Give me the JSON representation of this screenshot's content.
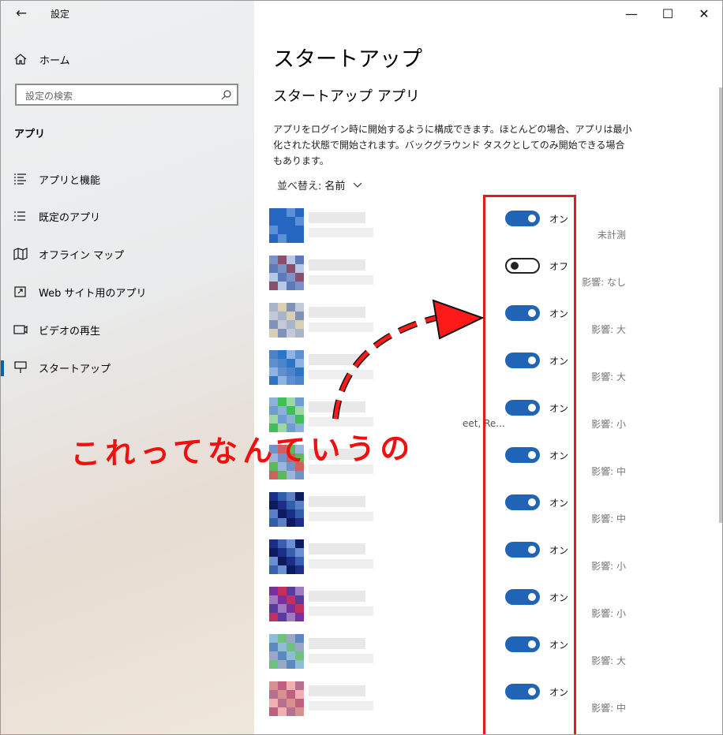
{
  "window": {
    "title": "設定",
    "controls": {
      "minimize": "—",
      "maximize": "☐",
      "close": "✕"
    }
  },
  "sidebar": {
    "home": "ホーム",
    "search_placeholder": "設定の検索",
    "section": "アプリ",
    "items": [
      {
        "label": "アプリと機能",
        "icon": "list-icon"
      },
      {
        "label": "既定のアプリ",
        "icon": "default-apps-icon"
      },
      {
        "label": "オフライン マップ",
        "icon": "map-icon"
      },
      {
        "label": "Web サイト用のアプリ",
        "icon": "open-in-app-icon"
      },
      {
        "label": "ビデオの再生",
        "icon": "video-icon"
      },
      {
        "label": "スタートアップ",
        "icon": "startup-icon",
        "selected": true
      }
    ]
  },
  "main": {
    "title": "スタートアップ",
    "subtitle": "スタートアップ アプリ",
    "description": "アプリをログイン時に開始するように構成できます。ほとんどの場合、アプリは最小化された状態で開始されます。バックグラウンド タスクとしてのみ開始できる場合もあります。",
    "sort_label": "並べ替え:",
    "sort_value": "名前",
    "apps": [
      {
        "state": "on",
        "toggle_label": "オン",
        "impact": "未計測"
      },
      {
        "state": "off",
        "toggle_label": "オフ",
        "impact": "影響: なし"
      },
      {
        "state": "on",
        "toggle_label": "オン",
        "impact": "影響: 大"
      },
      {
        "state": "on",
        "toggle_label": "オン",
        "impact": "影響: 大"
      },
      {
        "state": "on",
        "toggle_label": "オン",
        "impact": "影響: 小",
        "extra_text": "eet, Re..."
      },
      {
        "state": "on",
        "toggle_label": "オン",
        "impact": "影響: 中"
      },
      {
        "state": "on",
        "toggle_label": "オン",
        "impact": "影響: 中"
      },
      {
        "state": "on",
        "toggle_label": "オン",
        "impact": "影響: 小"
      },
      {
        "state": "on",
        "toggle_label": "オン",
        "impact": "影響: 小"
      },
      {
        "state": "on",
        "toggle_label": "オン",
        "impact": "影響: 大"
      },
      {
        "state": "on",
        "toggle_label": "オン",
        "impact": "影響: 中"
      }
    ]
  },
  "annotation": {
    "handwritten_text": "これってなんていうの",
    "color": "#f01010"
  },
  "colors": {
    "accent": "#1f64b6",
    "selected_indicator": "#0063b1",
    "annotation_red": "#e21b1b"
  }
}
